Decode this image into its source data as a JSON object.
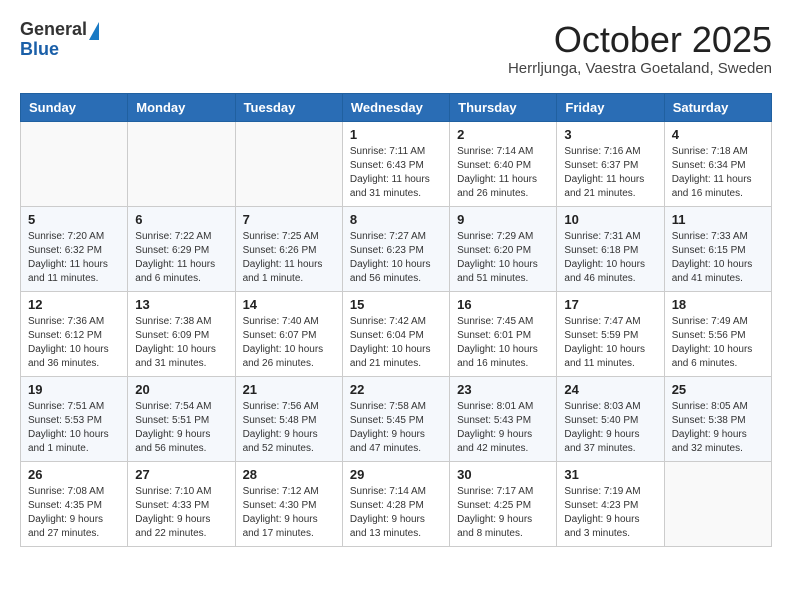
{
  "header": {
    "logo": {
      "general": "General",
      "blue": "Blue"
    },
    "title": "October 2025",
    "location": "Herrljunga, Vaestra Goetaland, Sweden"
  },
  "calendar": {
    "weekdays": [
      "Sunday",
      "Monday",
      "Tuesday",
      "Wednesday",
      "Thursday",
      "Friday",
      "Saturday"
    ],
    "weeks": [
      [
        {
          "day": "",
          "info": ""
        },
        {
          "day": "",
          "info": ""
        },
        {
          "day": "",
          "info": ""
        },
        {
          "day": "1",
          "info": "Sunrise: 7:11 AM\nSunset: 6:43 PM\nDaylight: 11 hours\nand 31 minutes."
        },
        {
          "day": "2",
          "info": "Sunrise: 7:14 AM\nSunset: 6:40 PM\nDaylight: 11 hours\nand 26 minutes."
        },
        {
          "day": "3",
          "info": "Sunrise: 7:16 AM\nSunset: 6:37 PM\nDaylight: 11 hours\nand 21 minutes."
        },
        {
          "day": "4",
          "info": "Sunrise: 7:18 AM\nSunset: 6:34 PM\nDaylight: 11 hours\nand 16 minutes."
        }
      ],
      [
        {
          "day": "5",
          "info": "Sunrise: 7:20 AM\nSunset: 6:32 PM\nDaylight: 11 hours\nand 11 minutes."
        },
        {
          "day": "6",
          "info": "Sunrise: 7:22 AM\nSunset: 6:29 PM\nDaylight: 11 hours\nand 6 minutes."
        },
        {
          "day": "7",
          "info": "Sunrise: 7:25 AM\nSunset: 6:26 PM\nDaylight: 11 hours\nand 1 minute."
        },
        {
          "day": "8",
          "info": "Sunrise: 7:27 AM\nSunset: 6:23 PM\nDaylight: 10 hours\nand 56 minutes."
        },
        {
          "day": "9",
          "info": "Sunrise: 7:29 AM\nSunset: 6:20 PM\nDaylight: 10 hours\nand 51 minutes."
        },
        {
          "day": "10",
          "info": "Sunrise: 7:31 AM\nSunset: 6:18 PM\nDaylight: 10 hours\nand 46 minutes."
        },
        {
          "day": "11",
          "info": "Sunrise: 7:33 AM\nSunset: 6:15 PM\nDaylight: 10 hours\nand 41 minutes."
        }
      ],
      [
        {
          "day": "12",
          "info": "Sunrise: 7:36 AM\nSunset: 6:12 PM\nDaylight: 10 hours\nand 36 minutes."
        },
        {
          "day": "13",
          "info": "Sunrise: 7:38 AM\nSunset: 6:09 PM\nDaylight: 10 hours\nand 31 minutes."
        },
        {
          "day": "14",
          "info": "Sunrise: 7:40 AM\nSunset: 6:07 PM\nDaylight: 10 hours\nand 26 minutes."
        },
        {
          "day": "15",
          "info": "Sunrise: 7:42 AM\nSunset: 6:04 PM\nDaylight: 10 hours\nand 21 minutes."
        },
        {
          "day": "16",
          "info": "Sunrise: 7:45 AM\nSunset: 6:01 PM\nDaylight: 10 hours\nand 16 minutes."
        },
        {
          "day": "17",
          "info": "Sunrise: 7:47 AM\nSunset: 5:59 PM\nDaylight: 10 hours\nand 11 minutes."
        },
        {
          "day": "18",
          "info": "Sunrise: 7:49 AM\nSunset: 5:56 PM\nDaylight: 10 hours\nand 6 minutes."
        }
      ],
      [
        {
          "day": "19",
          "info": "Sunrise: 7:51 AM\nSunset: 5:53 PM\nDaylight: 10 hours\nand 1 minute."
        },
        {
          "day": "20",
          "info": "Sunrise: 7:54 AM\nSunset: 5:51 PM\nDaylight: 9 hours\nand 56 minutes."
        },
        {
          "day": "21",
          "info": "Sunrise: 7:56 AM\nSunset: 5:48 PM\nDaylight: 9 hours\nand 52 minutes."
        },
        {
          "day": "22",
          "info": "Sunrise: 7:58 AM\nSunset: 5:45 PM\nDaylight: 9 hours\nand 47 minutes."
        },
        {
          "day": "23",
          "info": "Sunrise: 8:01 AM\nSunset: 5:43 PM\nDaylight: 9 hours\nand 42 minutes."
        },
        {
          "day": "24",
          "info": "Sunrise: 8:03 AM\nSunset: 5:40 PM\nDaylight: 9 hours\nand 37 minutes."
        },
        {
          "day": "25",
          "info": "Sunrise: 8:05 AM\nSunset: 5:38 PM\nDaylight: 9 hours\nand 32 minutes."
        }
      ],
      [
        {
          "day": "26",
          "info": "Sunrise: 7:08 AM\nSunset: 4:35 PM\nDaylight: 9 hours\nand 27 minutes."
        },
        {
          "day": "27",
          "info": "Sunrise: 7:10 AM\nSunset: 4:33 PM\nDaylight: 9 hours\nand 22 minutes."
        },
        {
          "day": "28",
          "info": "Sunrise: 7:12 AM\nSunset: 4:30 PM\nDaylight: 9 hours\nand 17 minutes."
        },
        {
          "day": "29",
          "info": "Sunrise: 7:14 AM\nSunset: 4:28 PM\nDaylight: 9 hours\nand 13 minutes."
        },
        {
          "day": "30",
          "info": "Sunrise: 7:17 AM\nSunset: 4:25 PM\nDaylight: 9 hours\nand 8 minutes."
        },
        {
          "day": "31",
          "info": "Sunrise: 7:19 AM\nSunset: 4:23 PM\nDaylight: 9 hours\nand 3 minutes."
        },
        {
          "day": "",
          "info": ""
        }
      ]
    ]
  }
}
